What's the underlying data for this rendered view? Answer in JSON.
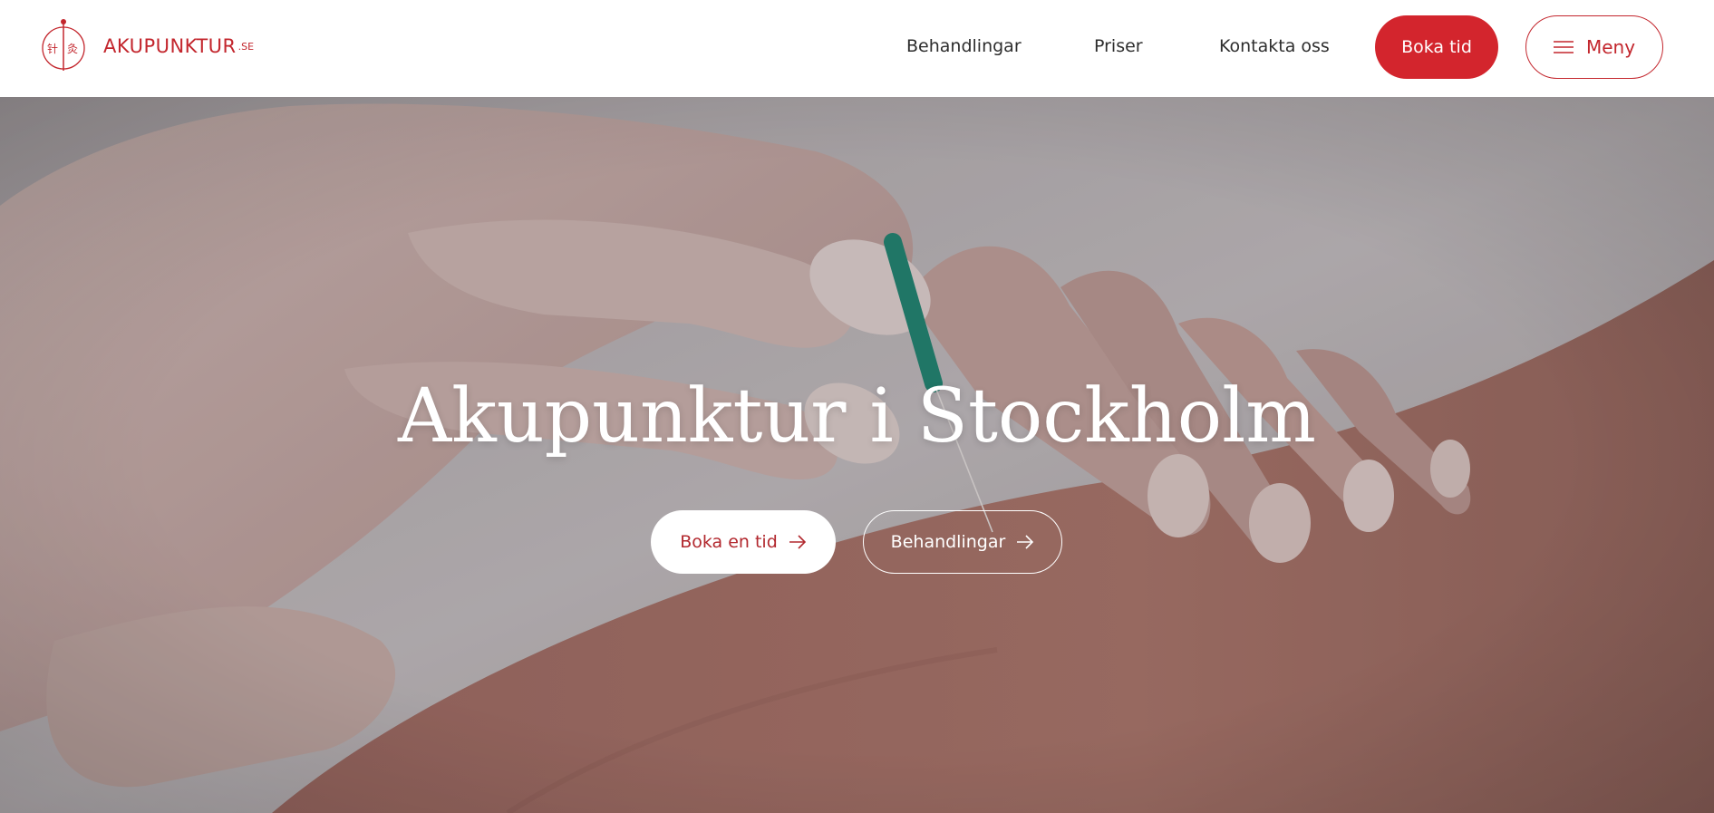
{
  "brand": {
    "name": "AKUPUNKTUR",
    "suffix": ".SE",
    "logo_icon": "acupuncture-needle-seal-icon",
    "color": "#c3262d"
  },
  "nav": {
    "items": [
      {
        "label": "Behandlingar"
      },
      {
        "label": "Priser"
      },
      {
        "label": "Kontakta oss"
      }
    ],
    "book_label": "Boka tid",
    "menu_label": "Meny",
    "menu_icon": "hamburger-icon",
    "book_color": "#d3252d"
  },
  "hero": {
    "title": "Akupunktur i Stockholm",
    "primary_button": "Boka en tid",
    "secondary_button": "Behandlingar",
    "button_icon": "arrow-right-icon",
    "image": "hands-acupuncture-needle-photo"
  }
}
